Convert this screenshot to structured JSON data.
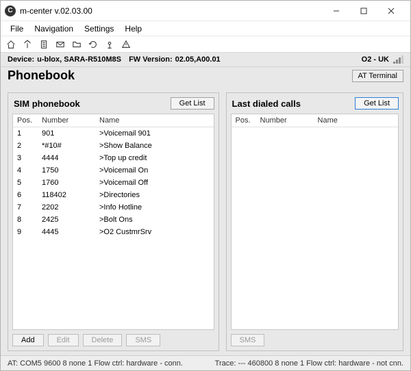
{
  "window": {
    "title": "m-center v.02.03.00"
  },
  "menubar": [
    "File",
    "Navigation",
    "Settings",
    "Help"
  ],
  "device": {
    "label_device": "Device:",
    "device": "u-blox, SARA-R510M8S",
    "label_fw": "FW Version:",
    "fw": "02.05,A00.01",
    "operator": "O2 - UK"
  },
  "page": {
    "title": "Phonebook",
    "at_terminal": "AT Terminal"
  },
  "sim_panel": {
    "title": "SIM phonebook",
    "getlist": "Get List",
    "cols": {
      "pos": "Pos.",
      "number": "Number",
      "name": "Name"
    },
    "rows": [
      {
        "pos": "1",
        "number": "901",
        "name": ">Voicemail 901"
      },
      {
        "pos": "2",
        "number": "*#10#",
        "name": ">Show Balance"
      },
      {
        "pos": "3",
        "number": "4444",
        "name": ">Top up credit"
      },
      {
        "pos": "4",
        "number": "1750",
        "name": ">Voicemail On"
      },
      {
        "pos": "5",
        "number": "1760",
        "name": ">Voicemail Off"
      },
      {
        "pos": "6",
        "number": "118402",
        "name": ">Directories"
      },
      {
        "pos": "7",
        "number": "2202",
        "name": ">Info Hotline"
      },
      {
        "pos": "8",
        "number": "2425",
        "name": ">Bolt Ons"
      },
      {
        "pos": "9",
        "number": "4445",
        "name": ">O2 CustmrSrv"
      }
    ],
    "buttons": {
      "add": "Add",
      "edit": "Edit",
      "delete": "Delete",
      "sms": "SMS"
    }
  },
  "dialed_panel": {
    "title": "Last dialed calls",
    "getlist": "Get List",
    "cols": {
      "pos": "Pos.",
      "number": "Number",
      "name": "Name"
    },
    "rows": [],
    "buttons": {
      "sms": "SMS"
    }
  },
  "status": {
    "left": "AT: COM5 9600 8 none 1 Flow ctrl: hardware - conn.",
    "right": "Trace: --- 460800 8 none 1 Flow ctrl: hardware - not cnn."
  }
}
